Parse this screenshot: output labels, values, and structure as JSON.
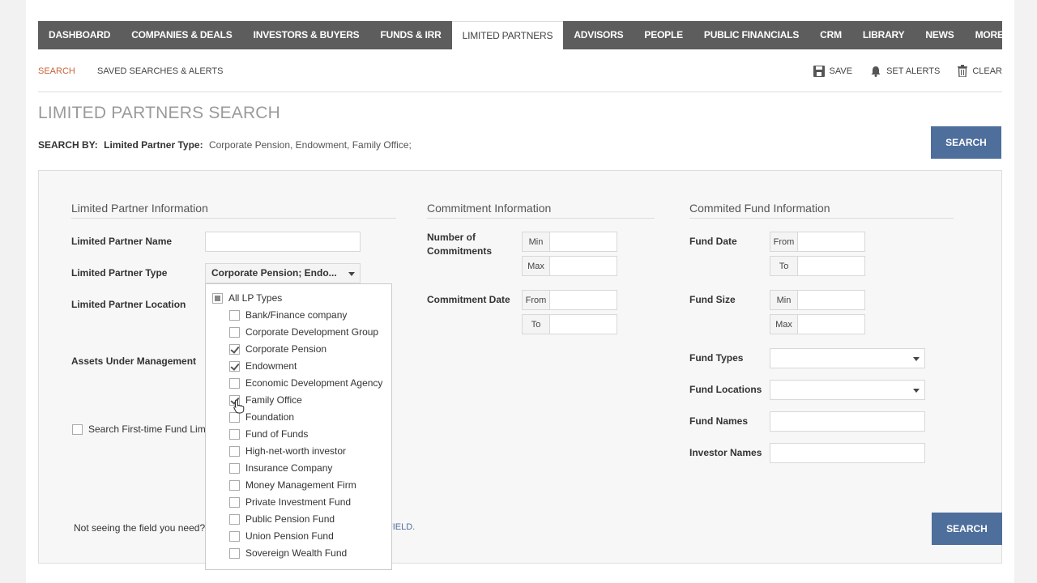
{
  "nav": {
    "items": [
      "DASHBOARD",
      "COMPANIES & DEALS",
      "INVESTORS & BUYERS",
      "FUNDS & IRR",
      "LIMITED PARTNERS",
      "ADVISORS",
      "PEOPLE",
      "PUBLIC FINANCIALS",
      "CRM",
      "LIBRARY",
      "NEWS"
    ],
    "active": "LIMITED PARTNERS",
    "more": "MORE ▼"
  },
  "subnav": {
    "search": "SEARCH",
    "saved": "SAVED SEARCHES & ALERTS",
    "save": "SAVE",
    "alerts": "SET ALERTS",
    "clear": "CLEAR"
  },
  "title": "LIMITED PARTNERS SEARCH",
  "search_by": {
    "label": "SEARCH BY:",
    "key": "Limited Partner Type:",
    "value": "Corporate Pension, Endowment, Family Office;"
  },
  "search_button": "SEARCH",
  "lp_info": {
    "title": "Limited Partner Information",
    "name_label": "Limited Partner Name",
    "type_label": "Limited Partner Type",
    "type_value": "Corporate Pension; Endo...",
    "location_label": "Limited Partner Location",
    "aum_label": "Assets Under Management",
    "first_time": "Search First-time Fund Limi"
  },
  "lp_types": {
    "all": "All LP Types",
    "options": [
      {
        "label": "Bank/Finance company",
        "checked": false
      },
      {
        "label": "Corporate Development Group",
        "checked": false
      },
      {
        "label": "Corporate Pension",
        "checked": true
      },
      {
        "label": "Endowment",
        "checked": true
      },
      {
        "label": "Economic Development Agency",
        "checked": false
      },
      {
        "label": "Family Office",
        "checked": true
      },
      {
        "label": "Foundation",
        "checked": false
      },
      {
        "label": "Fund of Funds",
        "checked": false
      },
      {
        "label": "High-net-worth investor",
        "checked": false
      },
      {
        "label": "Insurance Company",
        "checked": false
      },
      {
        "label": "Money Management Firm",
        "checked": false
      },
      {
        "label": "Private Investment Fund",
        "checked": false
      },
      {
        "label": "Public Pension Fund",
        "checked": false
      },
      {
        "label": "Union Pension Fund",
        "checked": false
      },
      {
        "label": "Sovereign Wealth Fund",
        "checked": false
      }
    ]
  },
  "commitment": {
    "title": "Commitment Information",
    "number_label": "Number of Commitments",
    "date_label": "Commitment Date",
    "min": "Min",
    "max": "Max",
    "from": "From",
    "to": "To"
  },
  "fund": {
    "title": "Commited Fund Information",
    "date_label": "Fund Date",
    "size_label": "Fund Size",
    "types_label": "Fund Types",
    "locations_label": "Fund Locations",
    "names_label": "Fund Names",
    "investor_label": "Investor Names",
    "min": "Min",
    "max": "Max",
    "from": "From",
    "to": "To"
  },
  "footer": {
    "note": "Not seeing the field you need?",
    "link": "FIELD."
  }
}
